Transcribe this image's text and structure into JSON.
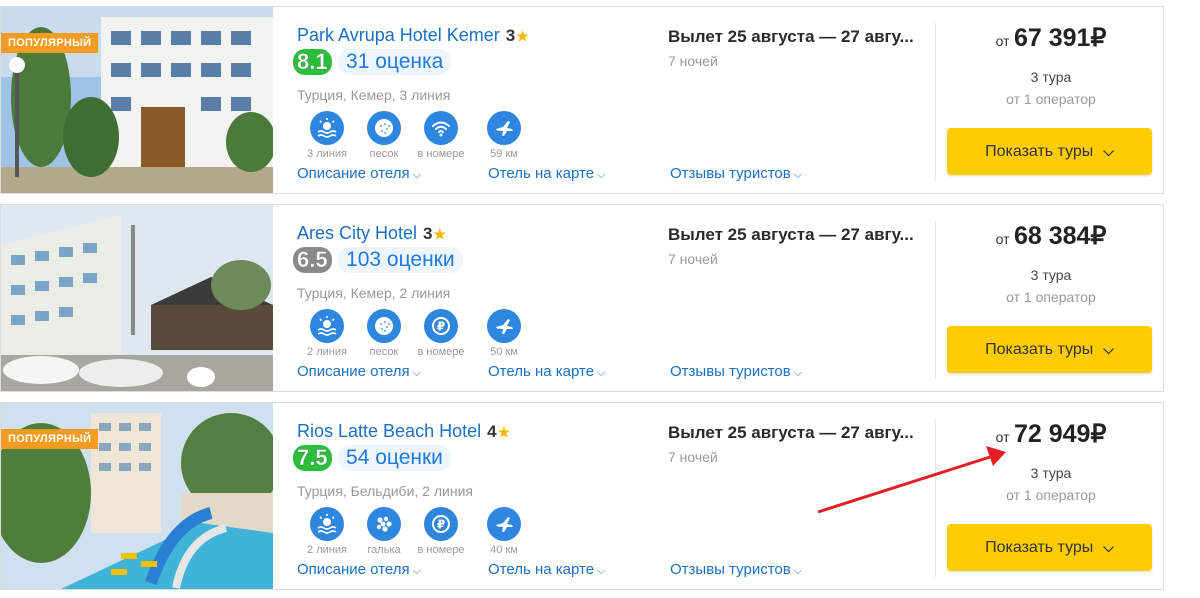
{
  "hotels": [
    {
      "badge": "ПОПУЛЯРНЫЙ",
      "name": "Park Avrupa Hotel Kemer",
      "stars": "3",
      "score": "8.1",
      "reviews": "31 оценка",
      "location": "Турция, Кемер, 3 линия",
      "amenities": [
        "3 линия",
        "песок",
        "в номере",
        "59 км"
      ],
      "flight": "Вылет 25 августа — 27 авгу...",
      "nights": "7 ночей",
      "price_from": "от",
      "price": "67 391₽",
      "tours": "3 тура",
      "operators": "от 1 оператор",
      "button": "Показать туры"
    },
    {
      "badge": "",
      "name": "Ares City Hotel",
      "stars": "3",
      "score": "6.5",
      "reviews": "103 оценки",
      "location": "Турция, Кемер, 2 линия",
      "amenities": [
        "2 линия",
        "песок",
        "в номере",
        "50 км"
      ],
      "flight": "Вылет 25 августа — 27 авгу...",
      "nights": "7 ночей",
      "price_from": "от",
      "price": "68 384₽",
      "tours": "3 тура",
      "operators": "от 1 оператор",
      "button": "Показать туры"
    },
    {
      "badge": "ПОПУЛЯРНЫЙ",
      "name": "Rios Latte Beach Hotel",
      "stars": "4",
      "score": "7.5",
      "reviews": "54 оценки",
      "location": "Турция, Бельдиби, 2 линия",
      "amenities": [
        "2 линия",
        "галька",
        "в номере",
        "40 км"
      ],
      "flight": "Вылет 25 августа — 27 авгу...",
      "nights": "7 ночей",
      "price_from": "от",
      "price": "72 949₽",
      "tours": "3 тура",
      "operators": "от 1 оператор",
      "button": "Показать туры"
    }
  ],
  "links": {
    "description": "Описание отеля",
    "map": "Отель на карте",
    "reviews": "Отзывы туристов"
  },
  "icons": {
    "amenity_row1": [
      "beach-line-icon",
      "sand-icon",
      "wifi-icon",
      "airport-distance-icon"
    ],
    "amenity_row2": [
      "beach-line-icon",
      "sand-icon",
      "paid-icon",
      "airport-distance-icon"
    ],
    "amenity_row3": [
      "beach-line-icon",
      "pebble-icon",
      "paid-icon",
      "airport-distance-icon"
    ]
  },
  "colors": {
    "link": "#1a6fc2",
    "badge": "#f59b20",
    "button": "#ffcc00",
    "score_good": "#2bbd3b",
    "score_mid": "#8a8a8a",
    "amenity": "#2e86de",
    "annotation_arrow": "#e31e24"
  }
}
